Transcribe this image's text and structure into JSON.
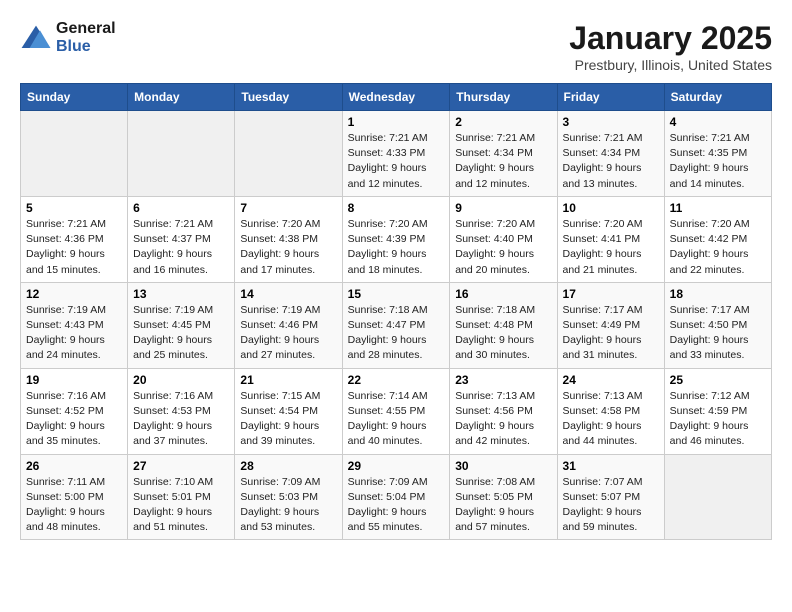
{
  "logo": {
    "line1": "General",
    "line2": "Blue"
  },
  "title": "January 2025",
  "location": "Prestbury, Illinois, United States",
  "days_of_week": [
    "Sunday",
    "Monday",
    "Tuesday",
    "Wednesday",
    "Thursday",
    "Friday",
    "Saturday"
  ],
  "weeks": [
    [
      {
        "day": "",
        "info": ""
      },
      {
        "day": "",
        "info": ""
      },
      {
        "day": "",
        "info": ""
      },
      {
        "day": "1",
        "info": "Sunrise: 7:21 AM\nSunset: 4:33 PM\nDaylight: 9 hours\nand 12 minutes."
      },
      {
        "day": "2",
        "info": "Sunrise: 7:21 AM\nSunset: 4:34 PM\nDaylight: 9 hours\nand 12 minutes."
      },
      {
        "day": "3",
        "info": "Sunrise: 7:21 AM\nSunset: 4:34 PM\nDaylight: 9 hours\nand 13 minutes."
      },
      {
        "day": "4",
        "info": "Sunrise: 7:21 AM\nSunset: 4:35 PM\nDaylight: 9 hours\nand 14 minutes."
      }
    ],
    [
      {
        "day": "5",
        "info": "Sunrise: 7:21 AM\nSunset: 4:36 PM\nDaylight: 9 hours\nand 15 minutes."
      },
      {
        "day": "6",
        "info": "Sunrise: 7:21 AM\nSunset: 4:37 PM\nDaylight: 9 hours\nand 16 minutes."
      },
      {
        "day": "7",
        "info": "Sunrise: 7:20 AM\nSunset: 4:38 PM\nDaylight: 9 hours\nand 17 minutes."
      },
      {
        "day": "8",
        "info": "Sunrise: 7:20 AM\nSunset: 4:39 PM\nDaylight: 9 hours\nand 18 minutes."
      },
      {
        "day": "9",
        "info": "Sunrise: 7:20 AM\nSunset: 4:40 PM\nDaylight: 9 hours\nand 20 minutes."
      },
      {
        "day": "10",
        "info": "Sunrise: 7:20 AM\nSunset: 4:41 PM\nDaylight: 9 hours\nand 21 minutes."
      },
      {
        "day": "11",
        "info": "Sunrise: 7:20 AM\nSunset: 4:42 PM\nDaylight: 9 hours\nand 22 minutes."
      }
    ],
    [
      {
        "day": "12",
        "info": "Sunrise: 7:19 AM\nSunset: 4:43 PM\nDaylight: 9 hours\nand 24 minutes."
      },
      {
        "day": "13",
        "info": "Sunrise: 7:19 AM\nSunset: 4:45 PM\nDaylight: 9 hours\nand 25 minutes."
      },
      {
        "day": "14",
        "info": "Sunrise: 7:19 AM\nSunset: 4:46 PM\nDaylight: 9 hours\nand 27 minutes."
      },
      {
        "day": "15",
        "info": "Sunrise: 7:18 AM\nSunset: 4:47 PM\nDaylight: 9 hours\nand 28 minutes."
      },
      {
        "day": "16",
        "info": "Sunrise: 7:18 AM\nSunset: 4:48 PM\nDaylight: 9 hours\nand 30 minutes."
      },
      {
        "day": "17",
        "info": "Sunrise: 7:17 AM\nSunset: 4:49 PM\nDaylight: 9 hours\nand 31 minutes."
      },
      {
        "day": "18",
        "info": "Sunrise: 7:17 AM\nSunset: 4:50 PM\nDaylight: 9 hours\nand 33 minutes."
      }
    ],
    [
      {
        "day": "19",
        "info": "Sunrise: 7:16 AM\nSunset: 4:52 PM\nDaylight: 9 hours\nand 35 minutes."
      },
      {
        "day": "20",
        "info": "Sunrise: 7:16 AM\nSunset: 4:53 PM\nDaylight: 9 hours\nand 37 minutes."
      },
      {
        "day": "21",
        "info": "Sunrise: 7:15 AM\nSunset: 4:54 PM\nDaylight: 9 hours\nand 39 minutes."
      },
      {
        "day": "22",
        "info": "Sunrise: 7:14 AM\nSunset: 4:55 PM\nDaylight: 9 hours\nand 40 minutes."
      },
      {
        "day": "23",
        "info": "Sunrise: 7:13 AM\nSunset: 4:56 PM\nDaylight: 9 hours\nand 42 minutes."
      },
      {
        "day": "24",
        "info": "Sunrise: 7:13 AM\nSunset: 4:58 PM\nDaylight: 9 hours\nand 44 minutes."
      },
      {
        "day": "25",
        "info": "Sunrise: 7:12 AM\nSunset: 4:59 PM\nDaylight: 9 hours\nand 46 minutes."
      }
    ],
    [
      {
        "day": "26",
        "info": "Sunrise: 7:11 AM\nSunset: 5:00 PM\nDaylight: 9 hours\nand 48 minutes."
      },
      {
        "day": "27",
        "info": "Sunrise: 7:10 AM\nSunset: 5:01 PM\nDaylight: 9 hours\nand 51 minutes."
      },
      {
        "day": "28",
        "info": "Sunrise: 7:09 AM\nSunset: 5:03 PM\nDaylight: 9 hours\nand 53 minutes."
      },
      {
        "day": "29",
        "info": "Sunrise: 7:09 AM\nSunset: 5:04 PM\nDaylight: 9 hours\nand 55 minutes."
      },
      {
        "day": "30",
        "info": "Sunrise: 7:08 AM\nSunset: 5:05 PM\nDaylight: 9 hours\nand 57 minutes."
      },
      {
        "day": "31",
        "info": "Sunrise: 7:07 AM\nSunset: 5:07 PM\nDaylight: 9 hours\nand 59 minutes."
      },
      {
        "day": "",
        "info": ""
      }
    ]
  ]
}
